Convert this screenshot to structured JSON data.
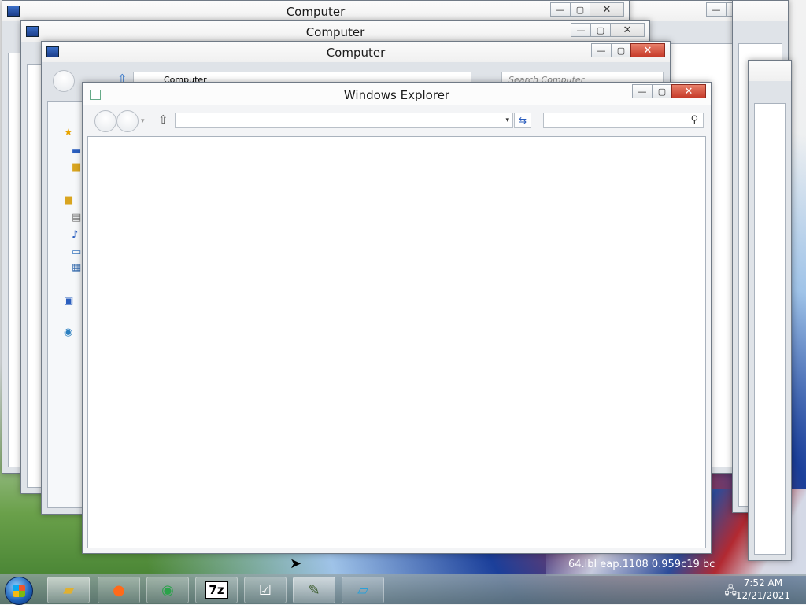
{
  "windows": {
    "back1": {
      "title": "Computer",
      "minimize": "—",
      "restore": "▢",
      "close": "✕"
    },
    "back2": {
      "title": "Computer",
      "minimize": "—",
      "restore": "▢",
      "close": "✕"
    },
    "back3": {
      "title": "Computer",
      "minimize": "—",
      "restore": "▢",
      "close": "✕",
      "breadcrumb": "Computer",
      "search_placeholder": "Search Computer"
    },
    "front": {
      "title": "Windows Explorer",
      "minimize": "—",
      "restore": "▢",
      "close": "✕",
      "address_value": "",
      "search_value": ""
    }
  },
  "desktop": {
    "overlay_text": "64.lbl  eap.1108  0.959c19  bc"
  },
  "taskbar": {
    "items": [
      {
        "name": "windows-explorer",
        "label": ""
      },
      {
        "name": "firefox",
        "label": ""
      },
      {
        "name": "chrome",
        "label": ""
      },
      {
        "name": "7zip",
        "label": "7z"
      },
      {
        "name": "checklist-app",
        "label": ""
      },
      {
        "name": "paint-app",
        "label": ""
      },
      {
        "name": "remote-desktop",
        "label": ""
      }
    ],
    "clock": {
      "time": "7:52 AM",
      "date": "12/21/2021"
    }
  },
  "icons": {
    "up": "⇧",
    "dropdown": "▾",
    "refresh": "⇆",
    "search": "⚲",
    "cursor": "➤",
    "network": "🖧"
  },
  "colors": {
    "close_red": "#c63b2a",
    "taskbar": "#5f7378"
  }
}
